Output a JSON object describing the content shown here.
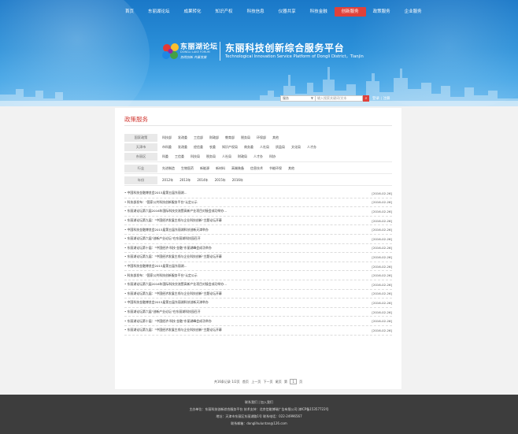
{
  "nav": {
    "items": [
      {
        "label": "首页",
        "active": false
      },
      {
        "label": "东丽湖论坛",
        "active": false
      },
      {
        "label": "成果转化",
        "active": false
      },
      {
        "label": "知识产权",
        "active": false
      },
      {
        "label": "科技信息",
        "active": false
      },
      {
        "label": "仪器共享",
        "active": false
      },
      {
        "label": "科技金融",
        "active": false
      },
      {
        "label": "创新服务",
        "active": true
      },
      {
        "label": "政策服务",
        "active": false
      },
      {
        "label": "企业服务",
        "active": false
      }
    ]
  },
  "brand": {
    "logo_cn": "东丽湖论坛",
    "logo_en": "DONGLI LAKE FORUM",
    "slogan": "协同创新  共赢发展",
    "site_title": "东丽科技创新综合服务平台",
    "site_subtitle": "Technological Innovation Service Platform of Dongli District，Tianjin"
  },
  "search": {
    "category": "服务",
    "placeholder": "输入搜索关键词/文本",
    "auth_text": "登录 | 注册"
  },
  "section_title": "政策服务",
  "filters": {
    "groups": [
      {
        "label": "国家政策",
        "options": [
          "科技部",
          "发改委",
          "工信部",
          "财政部",
          "教育部",
          "税务局",
          "环保部",
          "其他"
        ]
      },
      {
        "label": "天津市",
        "options": [
          "市科委",
          "发改委",
          "经信委",
          "农委",
          "知识产权局",
          "商务委",
          "人社局",
          "质监局",
          "文化局",
          "人才办"
        ]
      },
      {
        "label": "东丽区",
        "options": [
          "科委",
          "工信委",
          "科技局",
          "税务局",
          "人社局",
          "财政局",
          "人才办",
          "科协"
        ]
      },
      {
        "label": "行业",
        "options": [
          "先进制造",
          "生物医药",
          "新能源",
          "新材料",
          "高端装备",
          "信息技术",
          "节能环保",
          "其他"
        ]
      },
      {
        "label": "年份",
        "options": [
          "2012年",
          "2013年",
          "2014年",
          "2015年",
          "2016年"
        ]
      }
    ]
  },
  "news": [
    {
      "title": "• 中国科技金融博览会2015届第五届东丽湖…",
      "date": "[2016-02-26]"
    },
    {
      "title": "• 科技部发布：\"国家公共科技创新服务平台\"认定公示",
      "date": "[2016-02-26]"
    },
    {
      "title": "• 东丽湖论坛第六届2016年国际科技交流暨高新产业项目对接会成功举办…",
      "date": "[2016-02-26]"
    },
    {
      "title": "• 东丽湖论坛第九届：\"中国经济发展主线与企业科技创新\"主题论坛开幕",
      "date": "[2016-02-26]"
    },
    {
      "title": "• 中国科技金融博览会2015届第五届东丽湖科技创新天津举办",
      "date": "[2016-02-26]"
    },
    {
      "title": "• 东丽湖论坛第六届\"创新产业论坛\"在东丽湖科技园召开",
      "date": "[2016-02-26]"
    },
    {
      "title": "• 东丽湖论坛第十届：\"中国经济·科技·金融\"东丽湖峰会成功举办",
      "date": "[2016-02-26]"
    },
    {
      "title": "• 东丽湖论坛第九届：\"中国经济发展主线与企业科技创新\"主题论坛开幕",
      "date": "[2016-02-26]"
    },
    {
      "title": "• 中国科技金融博览会2015届第五届东丽湖…",
      "date": "[2016-02-26]"
    },
    {
      "title": "• 科技部发布：\"国家公共科技创新服务平台\"认定公示",
      "date": "[2016-02-26]"
    },
    {
      "title": "• 东丽湖论坛第六届2016年国际科技交流暨高新产业项目对接会成功举办…",
      "date": "[2016-02-26]"
    },
    {
      "title": "• 东丽湖论坛第九届：\"中国经济发展主线与企业科技创新\"主题论坛开幕",
      "date": "[2016-02-26]"
    },
    {
      "title": "• 中国科技金融博览会2015届第五届东丽湖科技创新天津举办",
      "date": "[2016-02-26]"
    },
    {
      "title": "• 东丽湖论坛第六届\"创新产业论坛\"在东丽湖科技园召开",
      "date": "[2016-02-26]"
    },
    {
      "title": "• 东丽湖论坛第十届：\"中国经济·科技·金融\"东丽湖峰会成功举办",
      "date": "[2016-02-26]"
    },
    {
      "title": "• 东丽湖论坛第九届：\"中国经济发展主线与企业科技创新\"主题论坛开幕",
      "date": "[2016-02-26]"
    }
  ],
  "pager": {
    "summary": "共16条记录 1/2页",
    "first": "首页",
    "prev": "上一页",
    "next": "下一页",
    "last": "尾页",
    "goto_prefix": "第",
    "current": "1",
    "goto_suffix": "页"
  },
  "footer": {
    "line1": "联系我们 | 加入我们",
    "line2": "主办单位：东丽科技创新综合服务平台  技术支持：北京信能博瑞广告有限公司  津ICP备15357722号",
    "line3": "地址：天津市东丽区东丽湖路1号  联系电话：022-24996567",
    "line4": "联系邮箱：donglihuluntan@126.com"
  },
  "colors": {
    "header_blue": "#2a8fd8",
    "accent_red": "#e0413a",
    "footer_bg": "#3d3d3d"
  }
}
